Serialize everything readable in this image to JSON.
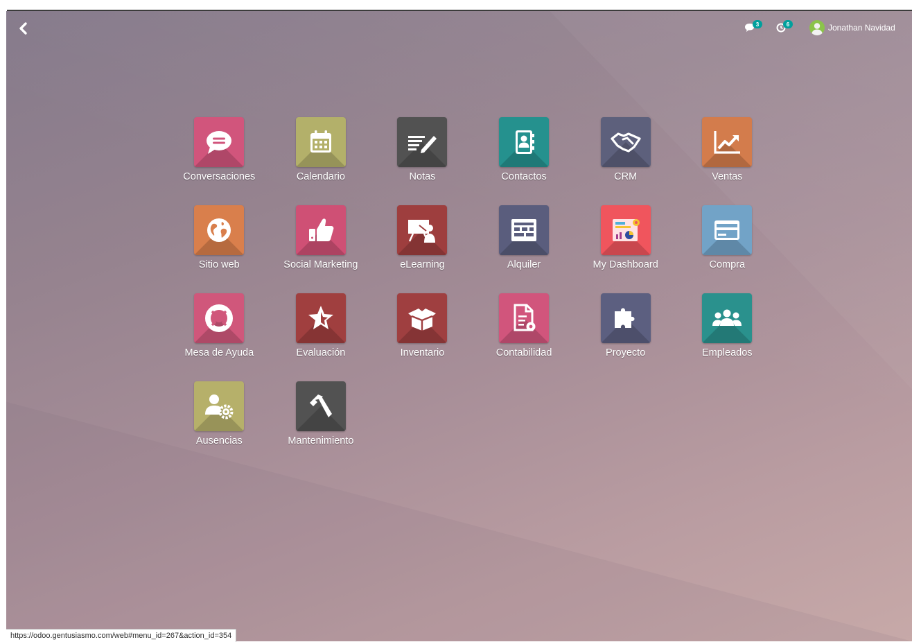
{
  "navbar": {
    "back_icon": "chevron-left-icon",
    "messages": {
      "icon": "chat-icon",
      "count": "3"
    },
    "activities": {
      "icon": "clock-icon",
      "count": "6"
    },
    "user": {
      "name": "Jonathan Navidad",
      "avatar_color": "#8bc34a"
    }
  },
  "apps": [
    {
      "label": "Conversaciones",
      "icon": "chat-bubble-icon",
      "color": "#d1557c"
    },
    {
      "label": "Calendario",
      "icon": "calendar-icon",
      "color": "#b3b06a"
    },
    {
      "label": "Notas",
      "icon": "notes-icon",
      "color": "#525252"
    },
    {
      "label": "Contactos",
      "icon": "address-book-icon",
      "color": "#25918e"
    },
    {
      "label": "CRM",
      "icon": "handshake-icon",
      "color": "#5d607c"
    },
    {
      "label": "Ventas",
      "icon": "sales-chart-icon",
      "color": "#d37c4c"
    },
    {
      "label": "Sitio web",
      "icon": "globe-icon",
      "color": "#d97f4c"
    },
    {
      "label": "Social Marketing",
      "icon": "thumbs-up-icon",
      "color": "#cf5075"
    },
    {
      "label": "eLearning",
      "icon": "presentation-icon",
      "color": "#9e3e3e"
    },
    {
      "label": "Alquiler",
      "icon": "rental-grid-icon",
      "color": "#5a5d7d"
    },
    {
      "label": "My Dashboard",
      "icon": "dashboard-icon",
      "color": "#f0555d"
    },
    {
      "label": "Compra",
      "icon": "credit-card-icon",
      "color": "#72a3c7"
    },
    {
      "label": "Mesa de Ayuda",
      "icon": "lifebuoy-icon",
      "color": "#d0577b"
    },
    {
      "label": "Evaluación",
      "icon": "star-icon",
      "color": "#a03f3f"
    },
    {
      "label": "Inventario",
      "icon": "box-icon",
      "color": "#9f3f40"
    },
    {
      "label": "Contabilidad",
      "icon": "document-gear-icon",
      "color": "#d1557c"
    },
    {
      "label": "Proyecto",
      "icon": "puzzle-icon",
      "color": "#5c5f80"
    },
    {
      "label": "Empleados",
      "icon": "users-icon",
      "color": "#2a918d"
    },
    {
      "label": "Ausencias",
      "icon": "user-gear-icon",
      "color": "#b6b06a"
    },
    {
      "label": "Mantenimiento",
      "icon": "hammer-icon",
      "color": "#525252"
    }
  ],
  "status_bar": {
    "url": "https://odoo.gentusiasmo.com/web#menu_id=267&action_id=354"
  }
}
